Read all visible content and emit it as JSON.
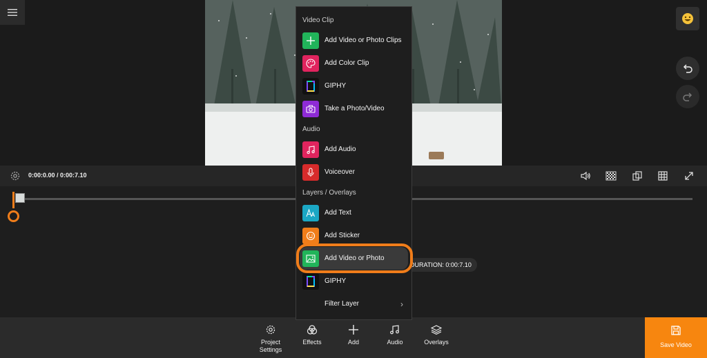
{
  "timebar": {
    "time": "0:00:0.00 / 0:00:7.10"
  },
  "timeline": {
    "duration": "DURATION: 0:00:7.10"
  },
  "menu": {
    "sections": [
      {
        "label": "Video Clip"
      },
      {
        "label": "Audio"
      },
      {
        "label": "Layers / Overlays"
      }
    ],
    "items": [
      {
        "label": "Add Video or Photo Clips",
        "icon": "plus-icon",
        "color": "#21b45a"
      },
      {
        "label": "Add Color Clip",
        "icon": "palette-icon",
        "color": "#e0245e"
      },
      {
        "label": "GIPHY",
        "icon": "giphy-icon",
        "color": "#111111"
      },
      {
        "label": "Take a Photo/Video",
        "icon": "camera-icon",
        "color": "#8e2bd6"
      },
      {
        "label": "Add Audio",
        "icon": "music-note-icon",
        "color": "#e0245e"
      },
      {
        "label": "Voiceover",
        "icon": "microphone-icon",
        "color": "#d72b2b"
      },
      {
        "label": "Add Text",
        "icon": "text-icon",
        "color": "#1ba7c4"
      },
      {
        "label": "Add Sticker",
        "icon": "smiley-icon",
        "color": "#f07d1a"
      },
      {
        "label": "Add Video or Photo",
        "icon": "image-icon",
        "color": "#21b45a"
      },
      {
        "label": "GIPHY",
        "icon": "giphy-icon",
        "color": "#111111"
      },
      {
        "label": "Filter Layer",
        "icon": "",
        "color": ""
      }
    ]
  },
  "toolbar": {
    "project_settings": "Project Settings",
    "effects": "Effects",
    "add": "Add",
    "audio": "Audio",
    "overlays": "Overlays",
    "save_video": "Save Video"
  },
  "colors": {
    "accent": "#f07d1a",
    "save_bg": "#f7860f"
  }
}
